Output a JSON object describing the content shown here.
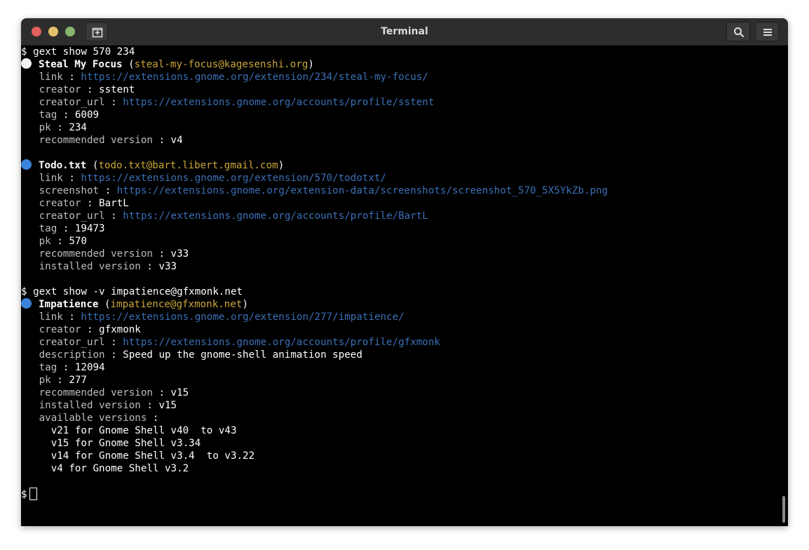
{
  "window": {
    "title": "Terminal"
  },
  "colors": {
    "background": "#000000",
    "titlebar": "#2d2d2d",
    "url": "#3b6fb6",
    "uuid": "#c9a63b",
    "bullet_enabled": "#3b82dc",
    "bullet_disabled": "#f2f2f2"
  },
  "prompt": "$",
  "commands": [
    "gext show 570 234",
    "gext show -v impatience@gfxmonk.net"
  ],
  "extensions": [
    {
      "bullet_icon": "white-circle-icon",
      "name": "Steal My Focus",
      "uuid": "steal-my-focus@kagesenshi.org",
      "fields": [
        {
          "key": "link",
          "value": "https://extensions.gnome.org/extension/234/steal-my-focus/",
          "is_url": true
        },
        {
          "key": "creator",
          "value": "sstent"
        },
        {
          "key": "creator_url",
          "value": "https://extensions.gnome.org/accounts/profile/sstent",
          "is_url": true
        },
        {
          "key": "tag",
          "value": "6009"
        },
        {
          "key": "pk",
          "value": "234"
        },
        {
          "key": "recommended version",
          "value": "v4"
        }
      ]
    },
    {
      "bullet_icon": "blue-circle-icon",
      "name": "Todo.txt",
      "uuid": "todo.txt@bart.libert.gmail.com",
      "fields": [
        {
          "key": "link",
          "value": "https://extensions.gnome.org/extension/570/todotxt/",
          "is_url": true
        },
        {
          "key": "screenshot",
          "value": "https://extensions.gnome.org/extension-data/screenshots/screenshot_570_5X5YkZb.png",
          "is_url": true
        },
        {
          "key": "creator",
          "value": "BartL"
        },
        {
          "key": "creator_url",
          "value": "https://extensions.gnome.org/accounts/profile/BartL",
          "is_url": true
        },
        {
          "key": "tag",
          "value": "19473"
        },
        {
          "key": "pk",
          "value": "570"
        },
        {
          "key": "recommended version",
          "value": "v33"
        },
        {
          "key": "installed version",
          "value": "v33"
        }
      ]
    },
    {
      "bullet_icon": "blue-circle-icon",
      "name": "Impatience",
      "uuid": "impatience@gfxmonk.net",
      "fields": [
        {
          "key": "link",
          "value": "https://extensions.gnome.org/extension/277/impatience/",
          "is_url": true
        },
        {
          "key": "creator",
          "value": "gfxmonk"
        },
        {
          "key": "creator_url",
          "value": "https://extensions.gnome.org/accounts/profile/gfxmonk",
          "is_url": true
        },
        {
          "key": "description",
          "value": "Speed up the gnome-shell animation speed"
        },
        {
          "key": "tag",
          "value": "12094"
        },
        {
          "key": "pk",
          "value": "277"
        },
        {
          "key": "recommended version",
          "value": "v15"
        },
        {
          "key": "installed version",
          "value": "v15"
        },
        {
          "key": "available versions",
          "value": ""
        }
      ],
      "available_versions": [
        "v21 for Gnome Shell v40  to v43",
        "v15 for Gnome Shell v3.34",
        "v14 for Gnome Shell v3.4  to v3.22",
        "v4 for Gnome Shell v3.2"
      ]
    }
  ],
  "icons": {
    "new_tab": "new-tab-icon",
    "search": "search-icon",
    "menu": "hamburger-menu-icon",
    "close": "close-icon",
    "minimize": "minimize-icon",
    "maximize": "maximize-icon"
  }
}
